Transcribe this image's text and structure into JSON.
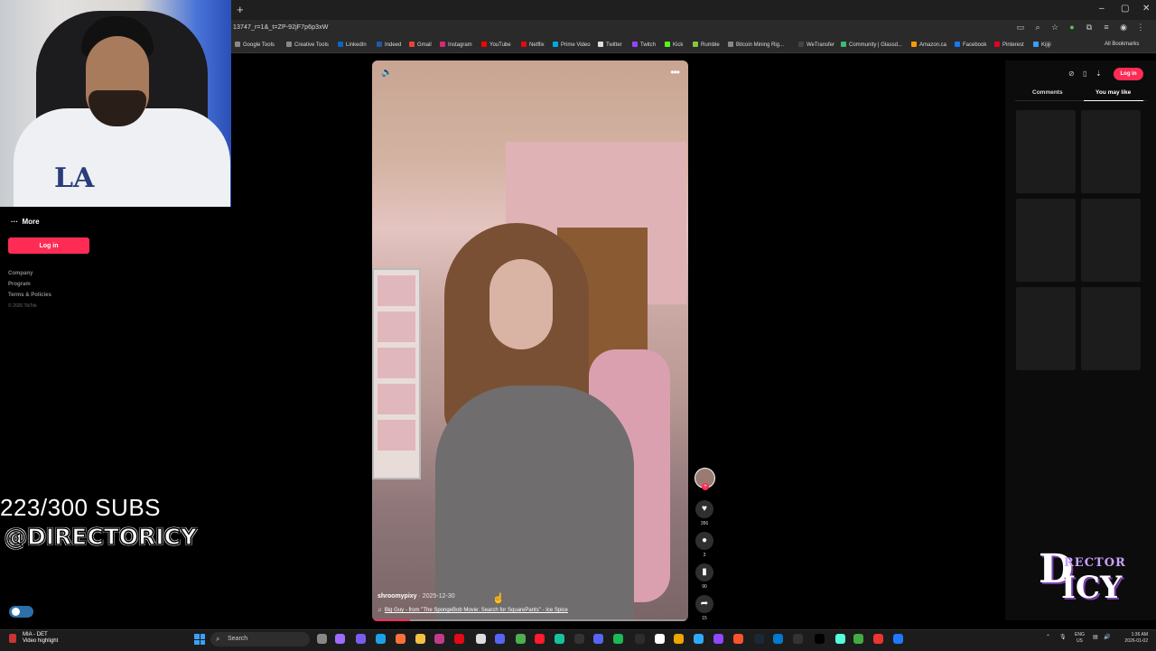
{
  "browser": {
    "url": "13747_r=1&_t=ZP-92jF7p6p3xW",
    "new_tab_symbol": "+",
    "window_controls": [
      "–",
      "▢",
      "✕"
    ],
    "bookmarks": [
      "Google Tools",
      "Creative Tools",
      "LinkedIn",
      "Indeed",
      "Gmail",
      "Instagram",
      "YouTube",
      "Netflix",
      "Prime Video",
      "Twitter",
      "Twitch",
      "Kick",
      "Rumble",
      "Bitcoin Mining Rig...",
      "WeTransfer",
      "Community | Glassd...",
      "Amazon.ca",
      "Facebook",
      "Pinterest",
      "Kijiji"
    ],
    "all_bookmarks": "All Bookmarks"
  },
  "sidebar": {
    "more_label": "More",
    "login_label": "Log in",
    "footer_links": [
      "Company",
      "Program",
      "Terms & Policies"
    ],
    "copyright": "© 2026 TikTok"
  },
  "overlay": {
    "subs": "223/300 SUBS",
    "handle": "@DIRECTORICY",
    "logo_big": "D",
    "logo_small": "RECTOR",
    "logo_icy": "ICY"
  },
  "video": {
    "author": "shroomypixy",
    "date": "· 2025-12-30",
    "music": "Big Guy - from \"The SpongeBob Movie: Search for SquarePants\" - Ice Spice",
    "progress": 0.12,
    "likes": "356",
    "comments": "3",
    "saves": "90",
    "shares": "15"
  },
  "right_panel": {
    "login_label": "Log in",
    "tabs": [
      "Comments",
      "You may like"
    ],
    "active_tab": "You may like"
  },
  "taskbar": {
    "weather_title": "MIA - DET",
    "weather_sub": "Video highlight",
    "search_placeholder": "Search",
    "lang_1": "ENG",
    "lang_2": "US",
    "time": "1:36 AM",
    "date": "2026-01-02"
  },
  "colors": {
    "accent": "#fe2c55",
    "taskbar_bg": "#1c1c1c",
    "panel_bg": "#0c0c0c"
  }
}
